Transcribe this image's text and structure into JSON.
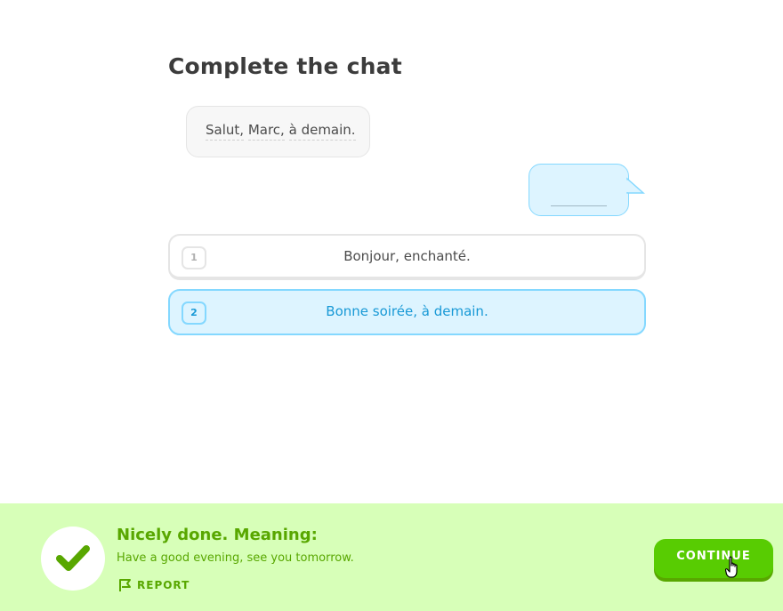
{
  "exercise": {
    "title": "Complete the chat"
  },
  "chat": {
    "left_message_words": [
      "Salut,",
      "Marc,",
      "à demain."
    ],
    "right_message_blank": ""
  },
  "options": [
    {
      "number": "1",
      "label": "Bonjour, enchanté.",
      "selected": false
    },
    {
      "number": "2",
      "label": "Bonne soirée, à demain.",
      "selected": true
    }
  ],
  "feedback": {
    "title": "Nicely done. Meaning:",
    "meaning": "Have a good evening, see you tomorrow.",
    "report_label": "REPORT",
    "continue_label": "CONTINUE",
    "status": "correct"
  },
  "icons": {
    "check": "check-icon",
    "report": "flag-icon",
    "cursor": "hand-pointer-icon"
  },
  "colors": {
    "success_bg": "#d7ffb8",
    "success_text": "#58a700",
    "button_green": "#58cc02",
    "selected_blue": "#1899d6",
    "selected_bg": "#ddf4ff"
  }
}
